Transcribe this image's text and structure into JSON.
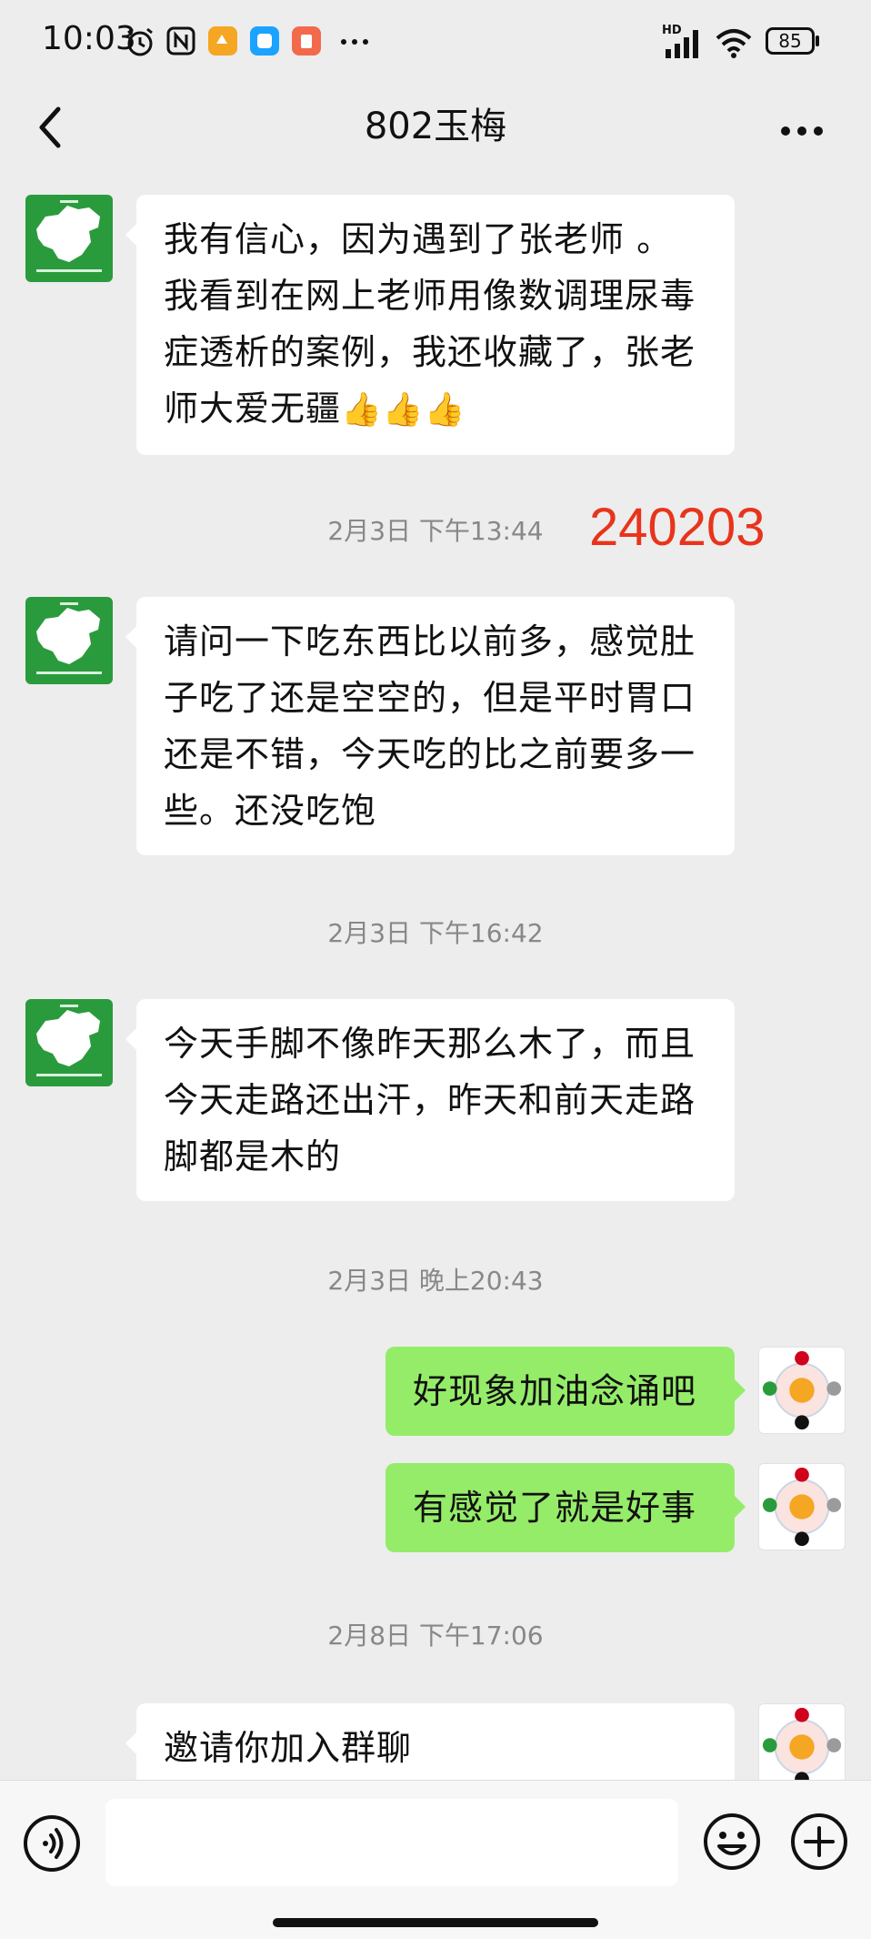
{
  "status_bar": {
    "time": "10:03",
    "hd_label": "HD",
    "battery": "85"
  },
  "header": {
    "title": "802玉梅"
  },
  "messages": [
    {
      "dir": "in",
      "text": "我有信心，因为遇到了张老师 。我看到在网上老师用像数调理尿毒症透析的案例，我还收藏了，张老师大爱无疆",
      "emoji": "👍👍👍"
    },
    {
      "timestamp": "2月3日 下午13:44",
      "stamp": "240203"
    },
    {
      "dir": "in",
      "text": "请问一下吃东西比以前多，感觉肚子吃了还是空空的，但是平时胃口还是不错，今天吃的比之前要多一些。还没吃饱"
    },
    {
      "timestamp": "2月3日 下午16:42"
    },
    {
      "dir": "in",
      "text": "今天手脚不像昨天那么木了，而且今天走路还出汗，昨天和前天走路脚都是木的"
    },
    {
      "timestamp": "2月3日 晚上20:43"
    },
    {
      "dir": "out",
      "text": "好现象加油念诵吧"
    },
    {
      "dir": "out",
      "text": "有感觉了就是好事"
    },
    {
      "timestamp": "2月8日 下午17:06"
    },
    {
      "dir": "out",
      "text": "邀请你加入群聊"
    }
  ],
  "colors": {
    "incoming_bubble": "#ffffff",
    "outgoing_bubble": "#95ec69",
    "background": "#ededed",
    "stamp": "#e8341c",
    "avatar_green": "#2a9b3c"
  },
  "input": {
    "value": "",
    "placeholder": ""
  },
  "icons": {
    "back": "chevron-left-icon",
    "more": "more-dots-icon",
    "voice": "voice-icon",
    "emoji": "smiley-icon",
    "plus": "plus-icon"
  }
}
